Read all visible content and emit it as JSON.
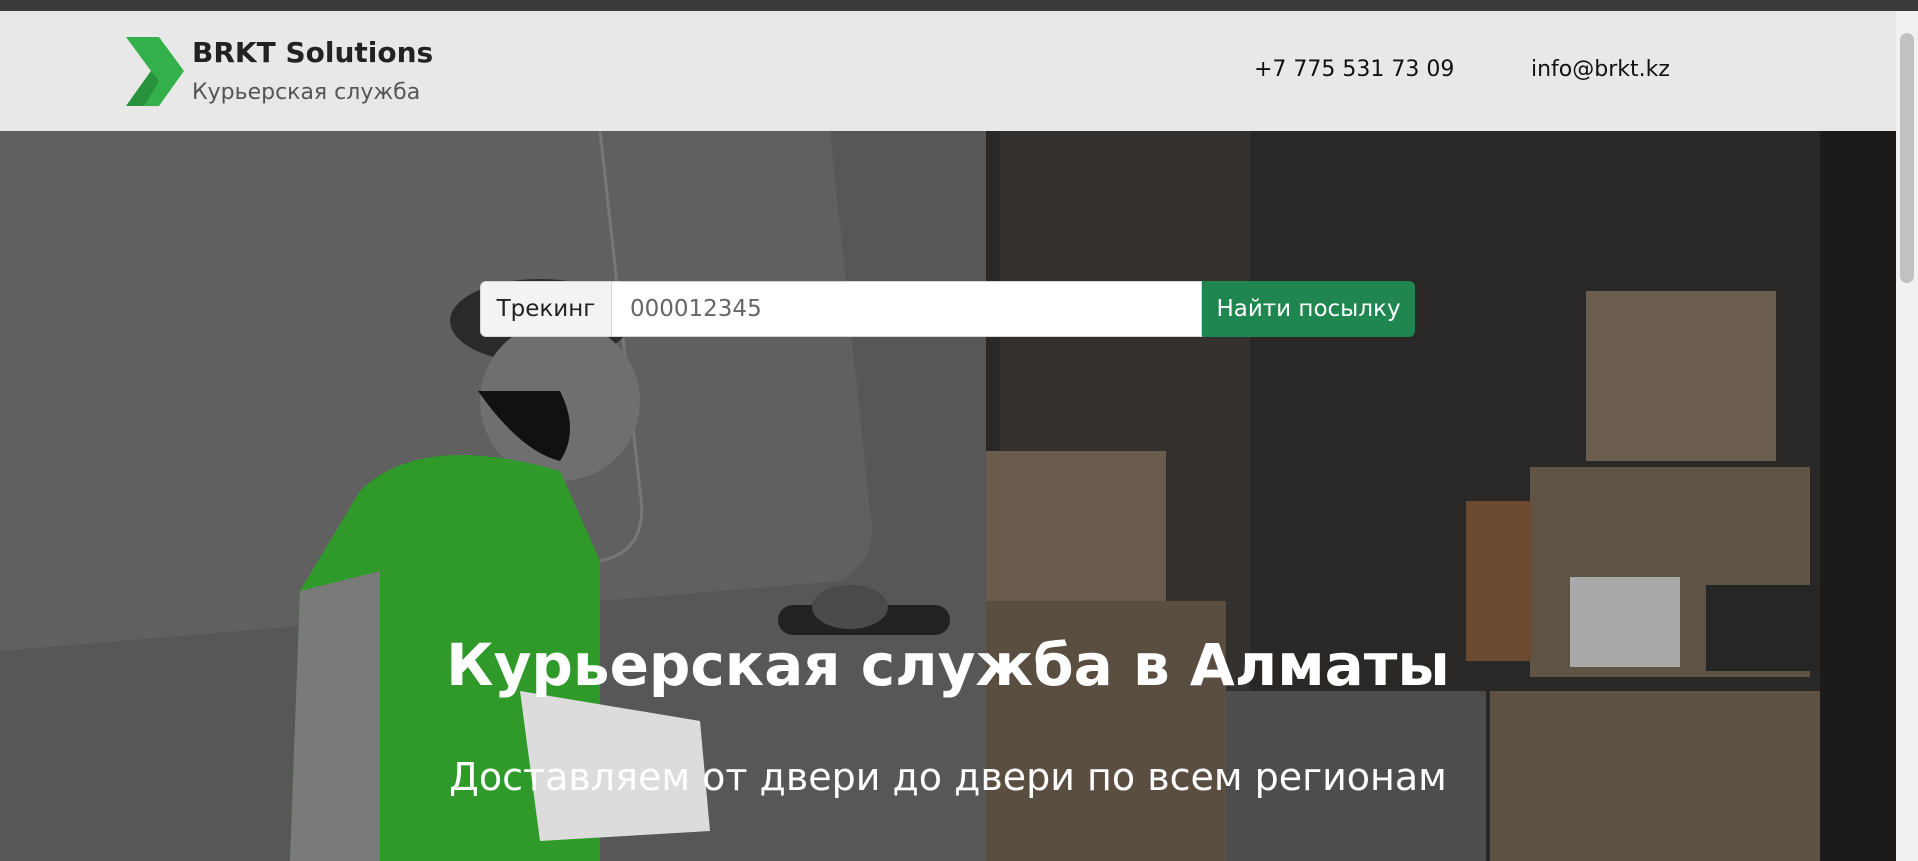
{
  "header": {
    "brand_name": "BRKT Solutions",
    "brand_subtitle": "Курьерская служба",
    "phone": "+7 775 531 73 09",
    "email": "info@brkt.kz"
  },
  "tracking": {
    "label": "Трекинг",
    "placeholder": "000012345",
    "button_label": "Найти посылку"
  },
  "hero": {
    "title": "Курьерская служба в Алматы",
    "subtitle": "Доставляем от двери до двери по всем регионам"
  },
  "colors": {
    "accent": "#1f8650",
    "logo_green": "#34b04a",
    "header_bg": "#e8e8e8"
  },
  "icons": {
    "logo": "green-chevron-logo"
  }
}
